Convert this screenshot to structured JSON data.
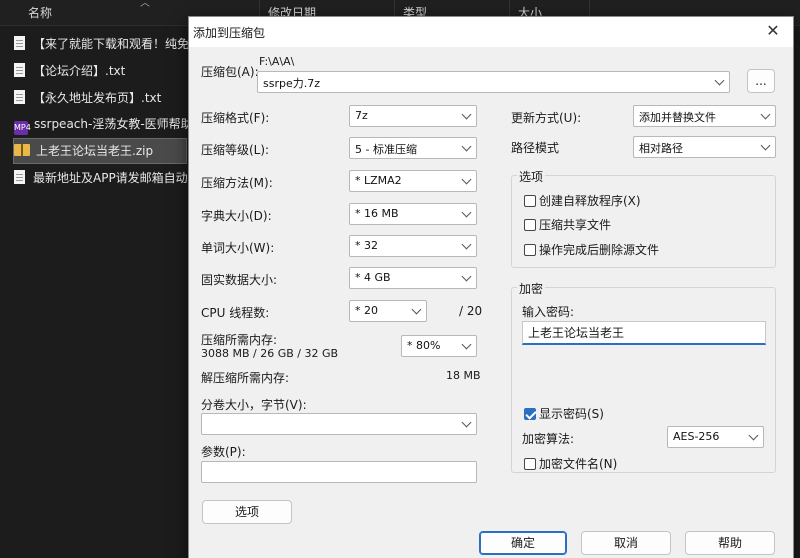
{
  "explorer": {
    "columns": [
      "名称",
      "修改日期",
      "类型",
      "大小"
    ],
    "files": [
      {
        "name": "【来了就能下载和观看！纯免费",
        "kind": "doc"
      },
      {
        "name": "【论坛介绍】.txt",
        "kind": "doc"
      },
      {
        "name": "【永久地址发布页】.txt",
        "kind": "doc"
      },
      {
        "name": "ssrpeach-淫荡女教-医师帮助",
        "kind": "video"
      },
      {
        "name": "上老王论坛当老王.zip",
        "kind": "zip",
        "selected": true
      },
      {
        "name": "最新地址及APP请发邮箱自动",
        "kind": "doc"
      }
    ],
    "video_icon_text": "MP4"
  },
  "dialog": {
    "title": "添加到压缩包",
    "close_glyph": "✕",
    "archive": {
      "label": "压缩包(A):",
      "path": "F:\\A\\A\\",
      "filename": "ssrpe力.7z",
      "browse_label": "..."
    },
    "left": {
      "format_label": "压缩格式(F):",
      "format_value": "7z",
      "level_label": "压缩等级(L):",
      "level_value": "5 - 标准压缩",
      "method_label": "压缩方法(M):",
      "method_value": "* LZMA2",
      "dict_label": "字典大小(D):",
      "dict_value": "* 16 MB",
      "word_label": "单词大小(W):",
      "word_value": "* 32",
      "solid_label": "固实数据大小:",
      "solid_value": "* 4 GB",
      "cpu_label": "CPU 线程数:",
      "cpu_value": "* 20",
      "cpu_total": "/ 20",
      "mem_comp_label": "压缩所需内存:",
      "mem_comp_detail": "3088 MB / 26 GB / 32 GB",
      "mem_comp_value": "* 80%",
      "mem_decomp_label": "解压缩所需内存:",
      "mem_decomp_value": "18 MB",
      "split_label": "分卷大小，字节(V):",
      "split_value": "",
      "params_label": "参数(P):",
      "params_value": "",
      "options_button": "选项"
    },
    "right": {
      "update_label": "更新方式(U):",
      "update_value": "添加并替换文件",
      "path_label": "路径模式",
      "path_value": "相对路径",
      "options_group": "选项",
      "opt_sfx": "创建自释放程序(X)",
      "opt_shared": "压缩共享文件",
      "opt_delete": "操作完成后删除源文件",
      "encrypt_group": "加密",
      "pwd_label": "输入密码:",
      "pwd_value": "上老王论坛当老王",
      "show_pwd": "显示密码(S)",
      "algo_label": "加密算法:",
      "algo_value": "AES-256",
      "encrypt_names": "加密文件名(N)"
    },
    "buttons": {
      "ok": "确定",
      "cancel": "取消",
      "help": "帮助"
    }
  }
}
